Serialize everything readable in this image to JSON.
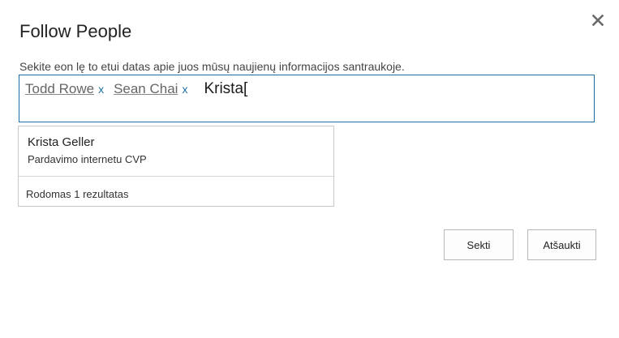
{
  "dialog": {
    "title": "Follow People",
    "instructions": "Sekite eon lę to etui datas apie juos mūsų naujienų informacijos santraukoje.",
    "close_icon": "close-icon"
  },
  "picker": {
    "tokens": [
      {
        "name": "Todd Rowe",
        "remove": "x"
      },
      {
        "name": "Sean Chai",
        "remove": "x"
      }
    ],
    "typed_text": "Krista["
  },
  "suggestions": {
    "items": [
      {
        "name": "Krista Geller",
        "title": "Pardavimo internetu CVP"
      }
    ],
    "footer": "Rodomas 1 rezultatas"
  },
  "buttons": {
    "follow_label": "Sekti",
    "cancel_label": "Atšaukti"
  }
}
